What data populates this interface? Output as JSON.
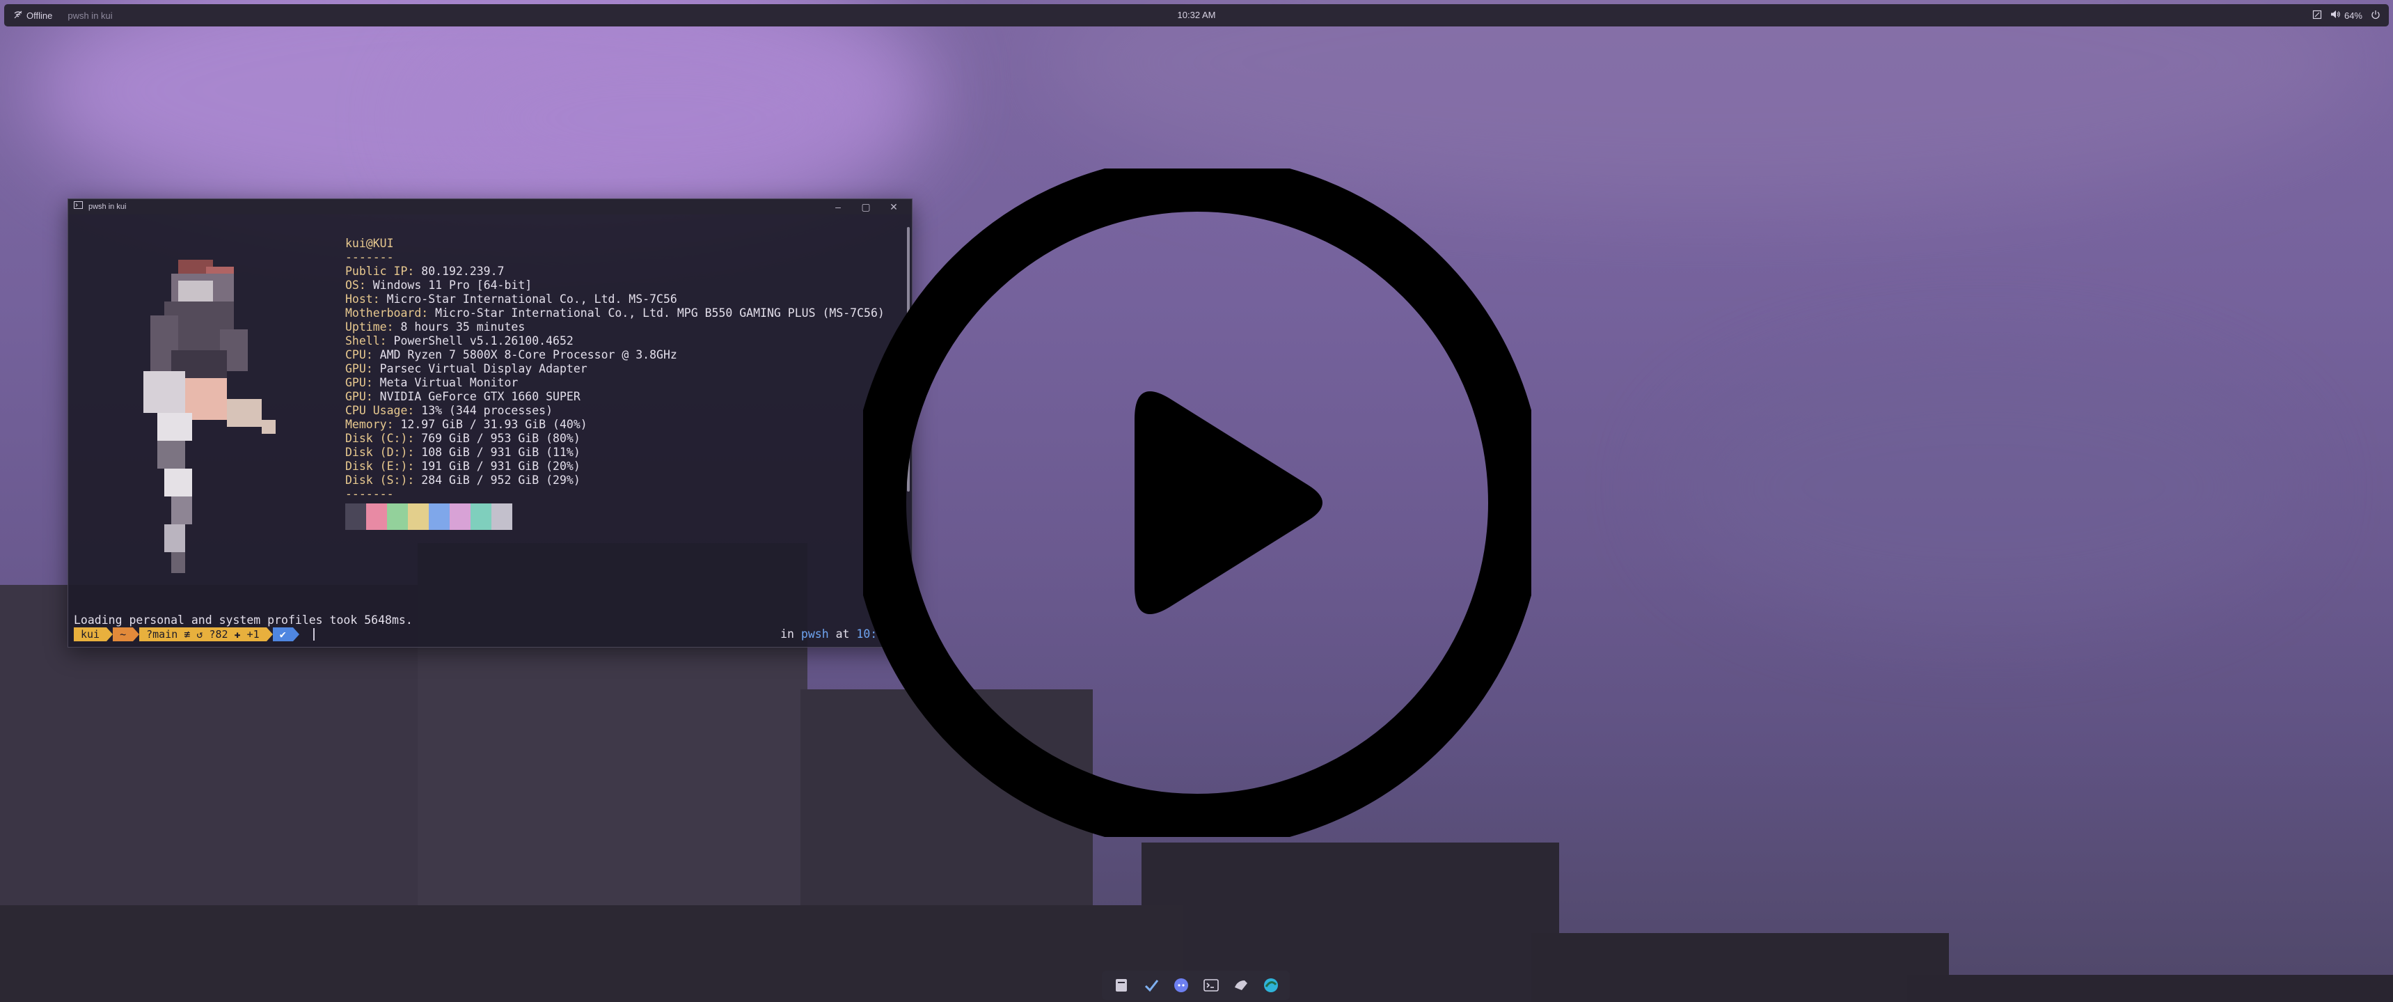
{
  "topbar": {
    "status": "Offline",
    "window_title": "pwsh in kui",
    "clock": "10:32 AM",
    "volume": "64%",
    "icons": [
      "wifi-off-icon",
      "tray-icon",
      "speaker-icon",
      "power-icon"
    ]
  },
  "terminal": {
    "title": "pwsh in kui",
    "controls": [
      "minimize",
      "maximize",
      "close"
    ],
    "fetch": {
      "user_host": "kui@KUI",
      "separator": "-------",
      "rows": [
        {
          "key": "Public IP",
          "value": " 80.192.239.7"
        },
        {
          "key": "OS",
          "value": " Windows 11 Pro [64-bit]"
        },
        {
          "key": "Host",
          "value": " Micro-Star International Co., Ltd. MS-7C56"
        },
        {
          "key": "Motherboard",
          "value": " Micro-Star International Co., Ltd. MPG B550 GAMING PLUS (MS-7C56)"
        },
        {
          "key": "Uptime",
          "value": " 8 hours 35 minutes"
        },
        {
          "key": "Shell",
          "value": " PowerShell v5.1.26100.4652"
        },
        {
          "key": "CPU",
          "value": " AMD Ryzen 7 5800X 8-Core Processor @ 3.8GHz"
        },
        {
          "key": "GPU",
          "value": " Parsec Virtual Display Adapter"
        },
        {
          "key": "GPU",
          "value": " Meta Virtual Monitor"
        },
        {
          "key": "GPU",
          "value": " NVIDIA GeForce GTX 1660 SUPER"
        },
        {
          "key": "CPU Usage",
          "value": " 13% (344 processes)"
        },
        {
          "key": "Memory",
          "value": " 12.97 GiB / 31.93 GiB (40%)"
        },
        {
          "key": "Disk (C:)",
          "value": " 769 GiB / 953 GiB (80%)"
        },
        {
          "key": "Disk (D:)",
          "value": " 108 GiB / 931 GiB (11%)"
        },
        {
          "key": "Disk (E:)",
          "value": " 191 GiB / 931 GiB (20%)"
        },
        {
          "key": "Disk (S:)",
          "value": " 284 GiB / 952 GiB (29%)"
        }
      ],
      "separator_end": "-------",
      "palette": [
        "#4a4658",
        "#e88aa4",
        "#93d19b",
        "#e3cf8c",
        "#7fa7ea",
        "#d8a2d6",
        "#7fcfbd",
        "#c3c0cc"
      ]
    },
    "load_line": "Loading personal and system profiles took 5648ms.",
    "prompt": {
      "segments": [
        {
          "text": "kui",
          "bg": "#e8b03d"
        },
        {
          "text": "~",
          "bg": "#e28a3a"
        },
        {
          "text": "?main ≢ ↺ ?82 ✚ +1",
          "bg": "#e8b03d"
        },
        {
          "text": "✔",
          "bg": "#4f86e0"
        }
      ],
      "right_prefix": "in ",
      "shell": "pwsh",
      "right_mid": " at ",
      "time": "10:28:"
    }
  },
  "overlay": {
    "icon": "play-button-icon"
  },
  "taskbar": {
    "apps": [
      {
        "name": "files-icon",
        "color": "#cfcbd9"
      },
      {
        "name": "checkmark-app-icon",
        "color": "#7fb0f0"
      },
      {
        "name": "discord-icon",
        "color": "#6d7ff0"
      },
      {
        "name": "terminal-icon",
        "color": "#d8d3e3"
      },
      {
        "name": "steam-icon",
        "color": "#cfcbd9"
      },
      {
        "name": "edge-icon",
        "color": "#2fb3d9"
      }
    ]
  }
}
